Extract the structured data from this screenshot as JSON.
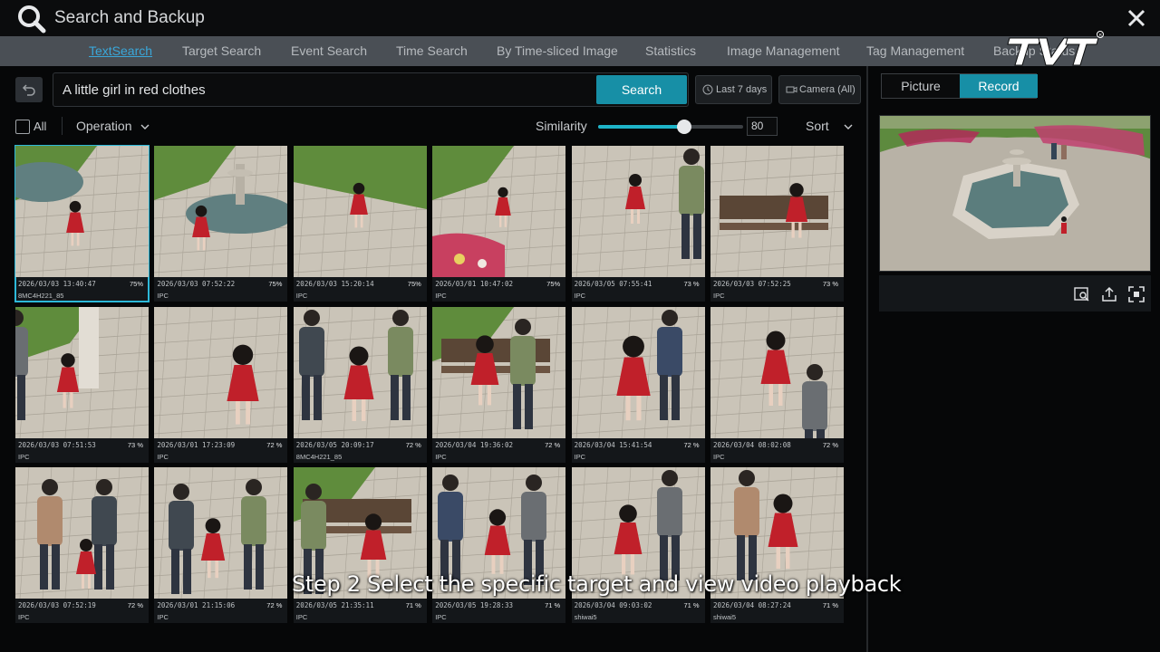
{
  "window": {
    "title": "Search and Backup",
    "brand": "TVT"
  },
  "tabs": [
    {
      "label": "TextSearch",
      "active": true
    },
    {
      "label": "Target Search"
    },
    {
      "label": "Event Search"
    },
    {
      "label": "Time Search"
    },
    {
      "label": "By Time-sliced Image"
    },
    {
      "label": "Statistics"
    },
    {
      "label": "Image Management"
    },
    {
      "label": "Tag Management"
    },
    {
      "label": "Backup Status"
    }
  ],
  "search": {
    "query": "A little girl in red clothes",
    "button_label": "Search",
    "time_filter": "Last 7 days",
    "camera_filter": "Camera (All)"
  },
  "toolbar": {
    "select_all_label": "All",
    "operation_label": "Operation",
    "similarity_label": "Similarity",
    "similarity_value": 80,
    "similarity_max": 100,
    "sort_label": "Sort"
  },
  "results": [
    {
      "time": "2026/03/03 13:40:47",
      "score": "75%",
      "camera": "8MC4H221_85",
      "selected": true,
      "scene": "fountain-close"
    },
    {
      "time": "2026/03/03 07:52:22",
      "score": "75%",
      "camera": "IPC",
      "scene": "fountain"
    },
    {
      "time": "2026/03/03 15:20:14",
      "score": "75%",
      "camera": "IPC",
      "scene": "lawn-path"
    },
    {
      "time": "2026/03/01 10:47:02",
      "score": "75%",
      "camera": "IPC",
      "scene": "flowers"
    },
    {
      "time": "2026/03/05 07:55:41",
      "score": "73 %",
      "camera": "IPC",
      "scene": "plaza"
    },
    {
      "time": "2026/03/03 07:52:25",
      "score": "73 %",
      "camera": "IPC",
      "scene": "bench-girl"
    },
    {
      "time": "2026/03/03 07:51:53",
      "score": "73 %",
      "camera": "IPC",
      "scene": "statue"
    },
    {
      "time": "2026/03/01 17:23:09",
      "score": "72 %",
      "camera": "IPC",
      "scene": "walk-red"
    },
    {
      "time": "2026/03/05 20:09:17",
      "score": "72 %",
      "camera": "8MC4H221_85",
      "scene": "family-walk"
    },
    {
      "time": "2026/03/04 19:36:02",
      "score": "72 %",
      "camera": "IPC",
      "scene": "bench-mom"
    },
    {
      "time": "2026/03/04 15:41:54",
      "score": "72 %",
      "camera": "IPC",
      "scene": "dad-walk"
    },
    {
      "time": "2026/03/04 08:02:08",
      "score": "72 %",
      "camera": "IPC",
      "scene": "crouch"
    },
    {
      "time": "2026/03/03 07:52:19",
      "score": "72 %",
      "camera": "IPC",
      "scene": "family3"
    },
    {
      "time": "2026/03/01 21:15:06",
      "score": "72 %",
      "camera": "IPC",
      "scene": "family4"
    },
    {
      "time": "2026/03/05 21:35:11",
      "score": "71 %",
      "camera": "IPC",
      "scene": "bench-sit"
    },
    {
      "time": "2026/03/05 19:28:33",
      "score": "71 %",
      "camera": "IPC",
      "scene": "family5"
    },
    {
      "time": "2026/03/04 09:03:02",
      "score": "71 %",
      "camera": "shiwai5",
      "scene": "family6"
    },
    {
      "time": "2026/03/04 08:27:24",
      "score": "71 %",
      "camera": "shiwai5",
      "scene": "family7"
    }
  ],
  "preview": {
    "tabs": [
      {
        "label": "Picture",
        "active": false
      },
      {
        "label": "Record",
        "active": true
      }
    ]
  },
  "caption": "Step 2 Select the specific target and view video playback",
  "colors": {
    "accent": "#178fa6",
    "active_tab": "#3aa7d9",
    "selection": "#2db9d9",
    "dress_red": "#c0202a"
  }
}
